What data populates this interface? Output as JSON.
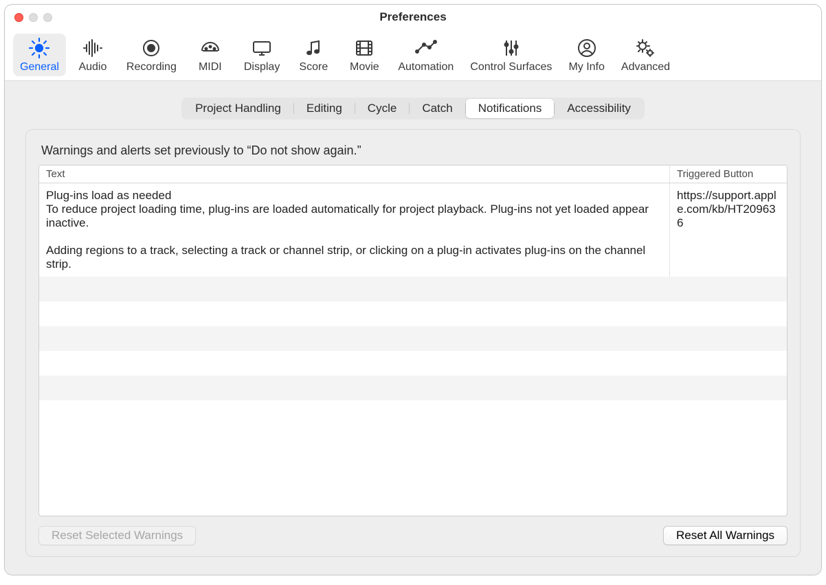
{
  "window": {
    "title": "Preferences"
  },
  "toolbar": {
    "items": [
      {
        "id": "general",
        "label": "General",
        "selected": true
      },
      {
        "id": "audio",
        "label": "Audio",
        "selected": false
      },
      {
        "id": "recording",
        "label": "Recording",
        "selected": false
      },
      {
        "id": "midi",
        "label": "MIDI",
        "selected": false
      },
      {
        "id": "display",
        "label": "Display",
        "selected": false
      },
      {
        "id": "score",
        "label": "Score",
        "selected": false
      },
      {
        "id": "movie",
        "label": "Movie",
        "selected": false
      },
      {
        "id": "automation",
        "label": "Automation",
        "selected": false
      },
      {
        "id": "control-surfaces",
        "label": "Control Surfaces",
        "selected": false
      },
      {
        "id": "my-info",
        "label": "My Info",
        "selected": false
      },
      {
        "id": "advanced",
        "label": "Advanced",
        "selected": false
      }
    ]
  },
  "tabs": {
    "items": [
      {
        "id": "project-handling",
        "label": "Project Handling",
        "active": false
      },
      {
        "id": "editing",
        "label": "Editing",
        "active": false
      },
      {
        "id": "cycle",
        "label": "Cycle",
        "active": false
      },
      {
        "id": "catch",
        "label": "Catch",
        "active": false
      },
      {
        "id": "notifications",
        "label": "Notifications",
        "active": true
      },
      {
        "id": "accessibility",
        "label": "Accessibility",
        "active": false
      }
    ]
  },
  "panel": {
    "description": "Warnings and alerts set previously to “Do not show again.”",
    "columns": {
      "text": "Text",
      "triggered": "Triggered Button"
    },
    "rows": [
      {
        "text": "Plug-ins load as needed\nTo reduce project loading time, plug-ins are loaded automatically for project playback. Plug-ins not yet loaded appear inactive.\n\nAdding regions to a track, selecting a track or channel strip, or clicking on a plug-in activates plug-ins on the channel strip.",
        "triggered": "https://support.apple.com/kb/HT209636"
      }
    ],
    "buttons": {
      "reset_selected": "Reset Selected Warnings",
      "reset_all": "Reset All Warnings"
    }
  }
}
